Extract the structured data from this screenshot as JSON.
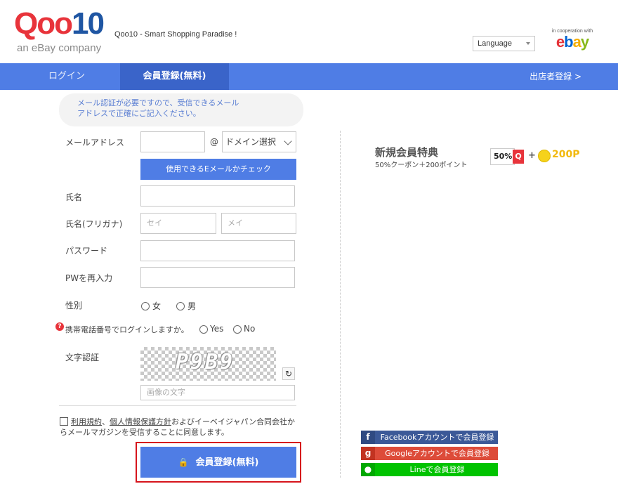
{
  "header": {
    "logo_text_red": "Qoo",
    "logo_text_blue": "10",
    "logo_sub": "an eBay company",
    "tagline": "Qoo10 - Smart Shopping Paradise !",
    "language_label": "Language",
    "ebay_coop_text": "in cooperation with",
    "ebay_letters": [
      "e",
      "b",
      "a",
      "y"
    ]
  },
  "nav": {
    "login": "ログイン",
    "register": "会員登録(無料)",
    "seller": "出店者登録 >"
  },
  "notice": {
    "line1": "メール認証が必要ですので、受信できるメール",
    "line2": "アドレスで正確にご記入ください。"
  },
  "form": {
    "email_label": "メールアドレス",
    "email_value": "",
    "at_sign": "@",
    "domain_select": "ドメイン選択",
    "check_email_button": "使用できるEメールかチェック",
    "name_label": "氏名",
    "name_value": "",
    "furigana_label": "氏名(フリガナ)",
    "furigana_sei_placeholder": "セイ",
    "furigana_mei_placeholder": "メイ",
    "password_label": "パスワード",
    "password_confirm_label": "PWを再入力",
    "gender_label": "性別",
    "gender_female": "女",
    "gender_male": "男",
    "help_icon": "?",
    "phone_login_label": "携帯電話番号でログインしますか。",
    "phone_yes": "Yes",
    "phone_no": "No",
    "captcha_label": "文字認証",
    "captcha_text": "P9B9",
    "refresh_icon": "↻",
    "captcha_placeholder": "画像の文字",
    "agree_terms_link": "利用規約",
    "agree_sep": "、",
    "agree_privacy_link": "個人情報保護方針",
    "agree_text": "およびイーベイジャパン合同会社からメールマガジンを受信することに同意します。",
    "submit_button": "会員登録(無料)",
    "lock_icon": "🔒"
  },
  "benefits": {
    "title": "新規会員特典",
    "subtitle": "50%クーポン＋200ポイント",
    "coupon_percent": "50%",
    "coupon_q": "Q",
    "plus": "+",
    "points": "200P"
  },
  "social": {
    "facebook_icon": "f",
    "facebook": "Facebookアカウントで会員登録",
    "google_icon": "g",
    "google": "Googleアカウントで会員登録",
    "line_icon": "●",
    "line": "Lineで会員登録"
  },
  "colors": {
    "nav_blue": "#4f7de5",
    "brand_red": "#e8343b",
    "brand_blue": "#1f56a3",
    "highlight_red": "#d6141c"
  }
}
